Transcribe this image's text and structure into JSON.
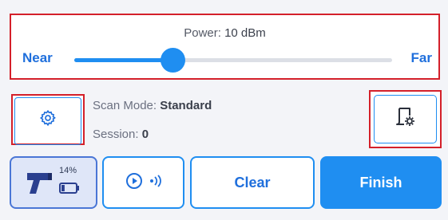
{
  "power": {
    "label": "Power:",
    "value": "10 dBm",
    "near_label": "Near",
    "far_label": "Far",
    "slider_fraction": 0.31
  },
  "scan": {
    "mode_label": "Scan Mode:",
    "mode_value": "Standard",
    "session_label": "Session:",
    "session_value": "0"
  },
  "device": {
    "battery_percent": "14%",
    "battery_fill": 0.14
  },
  "buttons": {
    "clear": "Clear",
    "finish": "Finish"
  },
  "icons": {
    "settings": "gear-icon",
    "config": "document-gear-icon",
    "device": "scanner-gun-icon",
    "battery": "battery-icon",
    "play": "play-circle-icon",
    "signal": "signal-icon"
  },
  "colors": {
    "accent": "#1f8ef1",
    "highlight_border": "#d4202a",
    "text_primary": "#3a3f4b",
    "link_blue": "#1f6fdc"
  }
}
